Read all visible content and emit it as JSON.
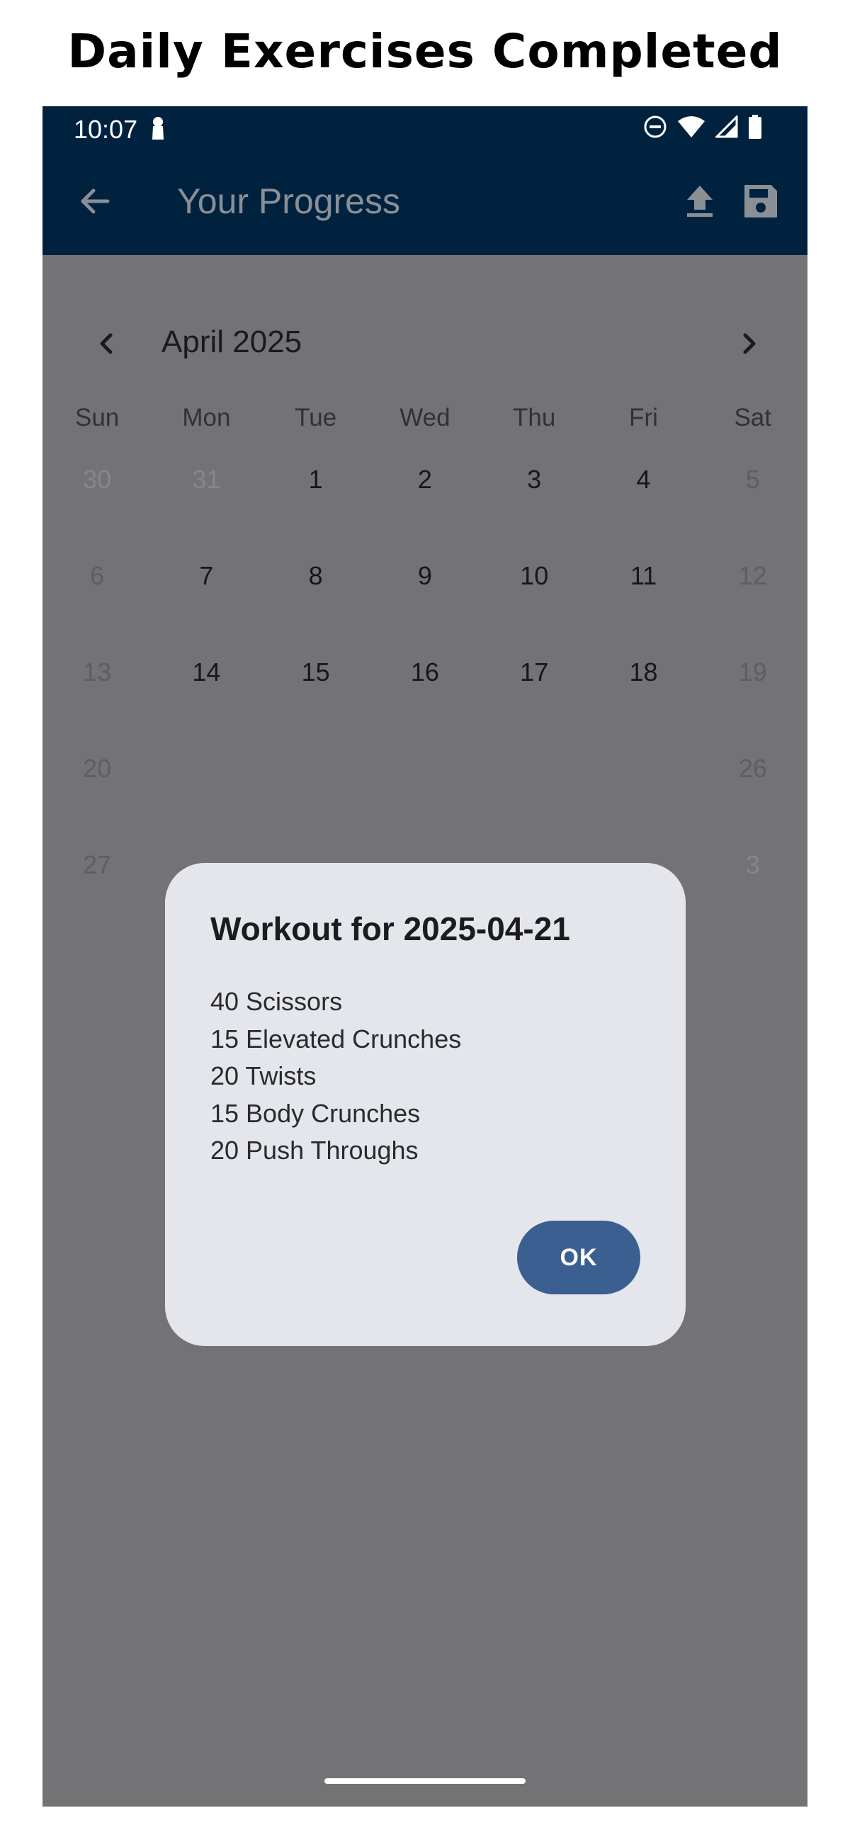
{
  "caption": "Daily Exercises Completed",
  "status_bar": {
    "time": "10:07",
    "icons": [
      "lock-icon",
      "dnd-icon",
      "wifi-icon",
      "signal-icon",
      "battery-icon"
    ]
  },
  "app_bar": {
    "title": "Your Progress",
    "icons": [
      "back-arrow-icon",
      "upload-icon",
      "save-icon"
    ]
  },
  "calendar": {
    "month_label": "April 2025",
    "weekdays": [
      "Sun",
      "Mon",
      "Tue",
      "Wed",
      "Thu",
      "Fri",
      "Sat"
    ],
    "weeks": [
      [
        "30",
        "31",
        "1",
        "2",
        "3",
        "4",
        "5"
      ],
      [
        "6",
        "7",
        "8",
        "9",
        "10",
        "11",
        "12"
      ],
      [
        "13",
        "14",
        "15",
        "16",
        "17",
        "18",
        "19"
      ],
      [
        "20",
        "",
        "",
        "",
        "",
        "",
        "26"
      ],
      [
        "27",
        "",
        "",
        "",
        "",
        "",
        "3"
      ]
    ]
  },
  "dialog": {
    "title": "Workout for 2025-04-21",
    "exercises": [
      "40 Scissors",
      "15 Elevated Crunches",
      "20 Twists",
      "15 Body Crunches",
      "20 Push Throughs"
    ],
    "ok_label": "OK"
  },
  "colors": {
    "app_bar": "#01223f",
    "scrim": "#737375",
    "dialog_bg": "#e5e6ec",
    "ok_button": "#3a5f90"
  }
}
